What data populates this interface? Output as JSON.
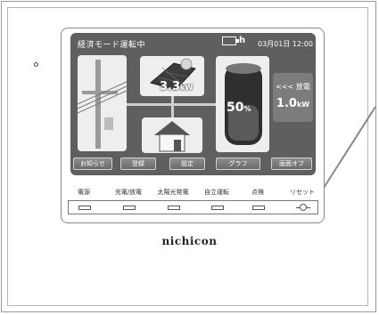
{
  "screen": {
    "mode_title": "経済モード運転中",
    "batt_suffix": "h",
    "date": "03月01日",
    "time": "12:00",
    "solar_power": "3.3",
    "solar_unit": "kW",
    "battery_percent": "50",
    "battery_unit": "%",
    "discharge_label": "<<< 放電",
    "discharge_value": "1.0",
    "discharge_unit": "kW",
    "buttons": [
      "お知らせ",
      "登録",
      "設定",
      "グラフ",
      "画面オフ"
    ]
  },
  "panel": {
    "function_labels": [
      "電源",
      "充電/放電",
      "太陽光発電",
      "自立運転",
      "点検",
      "リセット"
    ]
  },
  "brand": "nichicon",
  "colors": {
    "screen_bg": "#5f5f5f",
    "discharge_bg": "#7c7c7c",
    "frame": "#9a9a9a"
  }
}
